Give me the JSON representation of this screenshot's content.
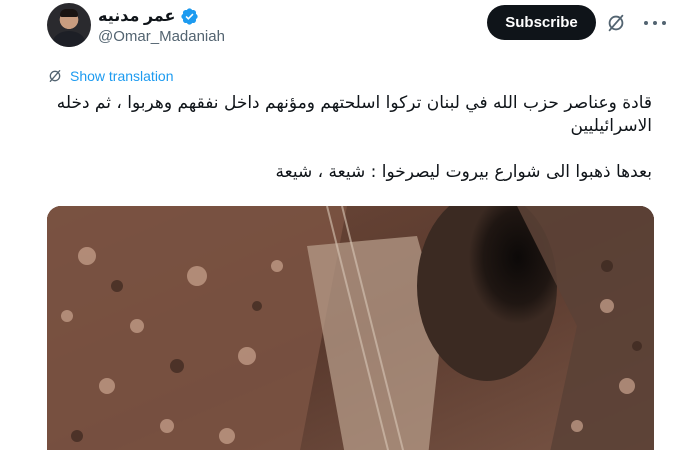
{
  "author": {
    "display_name": "عمر مدنيه",
    "handle": "@Omar_Madaniah",
    "verified": true
  },
  "actions": {
    "subscribe_label": "Subscribe"
  },
  "translation": {
    "label": "Show translation"
  },
  "tweet": {
    "paragraph_1": "قادة وعناصر حزب الله في لبنان تركوا اسلحتهم ومؤنهم داخل نفقهم وهربوا ، ثم دخله الاسرائيليين",
    "paragraph_2": "بعدها ذهبوا الى شوارع بيروت ليصرخوا : شيعة ، شيعة"
  },
  "media": {
    "type": "video",
    "description_icon": "video-thumbnail"
  },
  "colors": {
    "accent": "#1d9bf0",
    "text_primary": "#0f1419",
    "text_secondary": "#536471",
    "button_bg": "#0f1419"
  },
  "icons": {
    "verified": "verified-badge-icon",
    "grok": "grok-icon",
    "more": "more-icon",
    "translate": "translate-icon"
  }
}
